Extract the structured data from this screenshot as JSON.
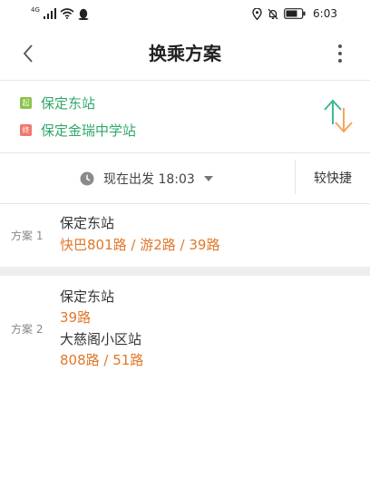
{
  "status_bar": {
    "network": "4G",
    "time": "6:03"
  },
  "header": {
    "title": "换乘方案"
  },
  "route": {
    "from_tag": "起",
    "from": "保定东站",
    "to_tag": "终",
    "to": "保定金瑞中学站"
  },
  "filter": {
    "time_label": "现在出发 18:03",
    "sort_label": "较快捷"
  },
  "plans": [
    {
      "label": "方案 1",
      "lines": [
        "保定东站",
        "快巴801路 / 游2路 / 39路"
      ]
    },
    {
      "label": "方案 2",
      "lines": [
        "保定东站",
        "39路",
        "大慈阁小区站",
        "808路 / 51路"
      ]
    }
  ],
  "colors": {
    "station_green": "#2fa86a",
    "route_orange": "#e0782a",
    "from_tag": "#8bc34a",
    "to_tag": "#f0776c"
  }
}
